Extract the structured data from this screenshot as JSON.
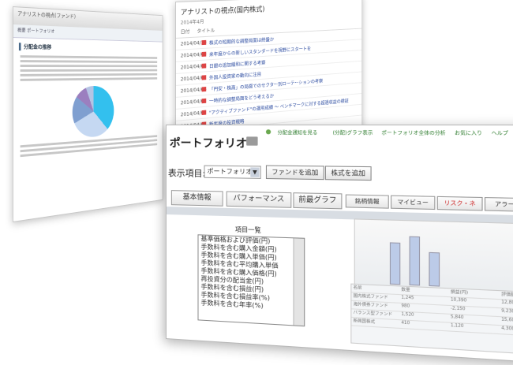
{
  "left_window": {
    "title": "アナリストの視点(ファンド)",
    "tabs": "概要  ポートフォリオ",
    "section": "分配金の推移"
  },
  "middle_window": {
    "title": "アナリストの視点(国内株式)",
    "subtitle": "2014年4月",
    "header_date": "日付",
    "header_title": "タイトル",
    "rows": [
      {
        "date": "2014/04/10",
        "text": "株式の短期的な調整局面は終盤か"
      },
      {
        "date": "2014/04/09",
        "text": "来年度からの新しいスタンダードを視野にスタートを"
      },
      {
        "date": "2014/04/08",
        "text": "日銀の追加緩和に関する考察"
      },
      {
        "date": "2014/04/07",
        "text": "外国人投資家の動向に注目"
      },
      {
        "date": "2014/04/04",
        "text": "「円安・株高」の局面でのセクター別ローテーションの考察"
      },
      {
        "date": "2014/04/03",
        "text": "一時的な調整局面をどう考えるか"
      },
      {
        "date": "2014/04/02",
        "text": "\"アクティブファンド\"の運用成績 ～ ベンチマークに対する超過収益の検証"
      },
      {
        "date": "2014/04/01",
        "text": "新年度の投資戦略"
      }
    ]
  },
  "front_window": {
    "title": "ポートフォリオ",
    "top_links": [
      "分配金通知を見る",
      "(分配)グラフ表示",
      "ポートフォリオ全体の分析",
      "お気に入り",
      "ヘルプ"
    ],
    "display_label": "表示項目:",
    "select_value": "ポートフォリオ1",
    "buttons": [
      "ファンドを追加",
      "株式を追加"
    ],
    "tabs": [
      "基本情報",
      "パフォーマンス",
      "前最グラフ",
      "銘柄情報",
      "マイビュー",
      "リスク・ネ",
      "アラート"
    ],
    "list_header": "項目一覧",
    "list_items": [
      "基準価格および評価(円)",
      "手数料を含む購入金額(円)",
      "手数料を含む購入単価(円)",
      "手数料を含む平均購入単価",
      "手数料を含む購入価格(円)",
      "再投資分の配当金(円)",
      "手数料を含む損益(円)",
      "手数料を含む損益率(%)",
      "手数料を含む年率(%)"
    ],
    "table_header": [
      "名前",
      "数量",
      "損益(円)",
      "評価額"
    ],
    "table_rows": [
      [
        "国内株式ファンド",
        "1,245",
        "10,390",
        "12,800"
      ],
      [
        "海外債券ファンド",
        "980",
        "-2,150",
        "9,230"
      ],
      [
        "バランス型ファンド",
        "1,520",
        "5,840",
        "15,600"
      ],
      [
        "新興国株式",
        "410",
        "1,120",
        "4,300"
      ]
    ]
  }
}
